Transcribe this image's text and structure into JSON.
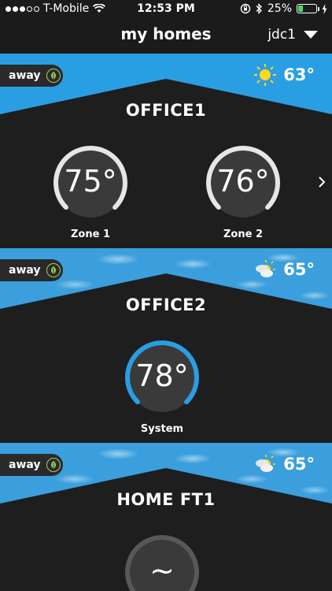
{
  "status_bar": {
    "carrier": "T-Mobile",
    "time": "12:53 PM",
    "battery": "25%",
    "battery_level": 0.25
  },
  "header": {
    "title": "my homes",
    "user": "jdc1"
  },
  "homes": [
    {
      "name": "OFFICE1",
      "mode": "away",
      "weather_icon": "sun-icon",
      "outdoor_temp": "63°",
      "zones": [
        {
          "temp": "75°",
          "label": "Zone 1"
        },
        {
          "temp": "76°",
          "label": "Zone 2"
        }
      ]
    },
    {
      "name": "OFFICE2",
      "mode": "away",
      "weather_icon": "partly-cloudy-icon",
      "outdoor_temp": "65°",
      "zones": [
        {
          "temp": "78°",
          "label": "System"
        }
      ]
    },
    {
      "name": "HOME FT1",
      "mode": "away",
      "weather_icon": "partly-cloudy-icon",
      "outdoor_temp": "65°",
      "zones": [
        {
          "temp": "~",
          "label": ""
        }
      ]
    }
  ],
  "colors": {
    "accent_blue": "#2a9ee3",
    "dial_blue": "#2a9ee3",
    "dial_grey": "#e6e6e6",
    "leaf_green": "#a3d15c"
  }
}
